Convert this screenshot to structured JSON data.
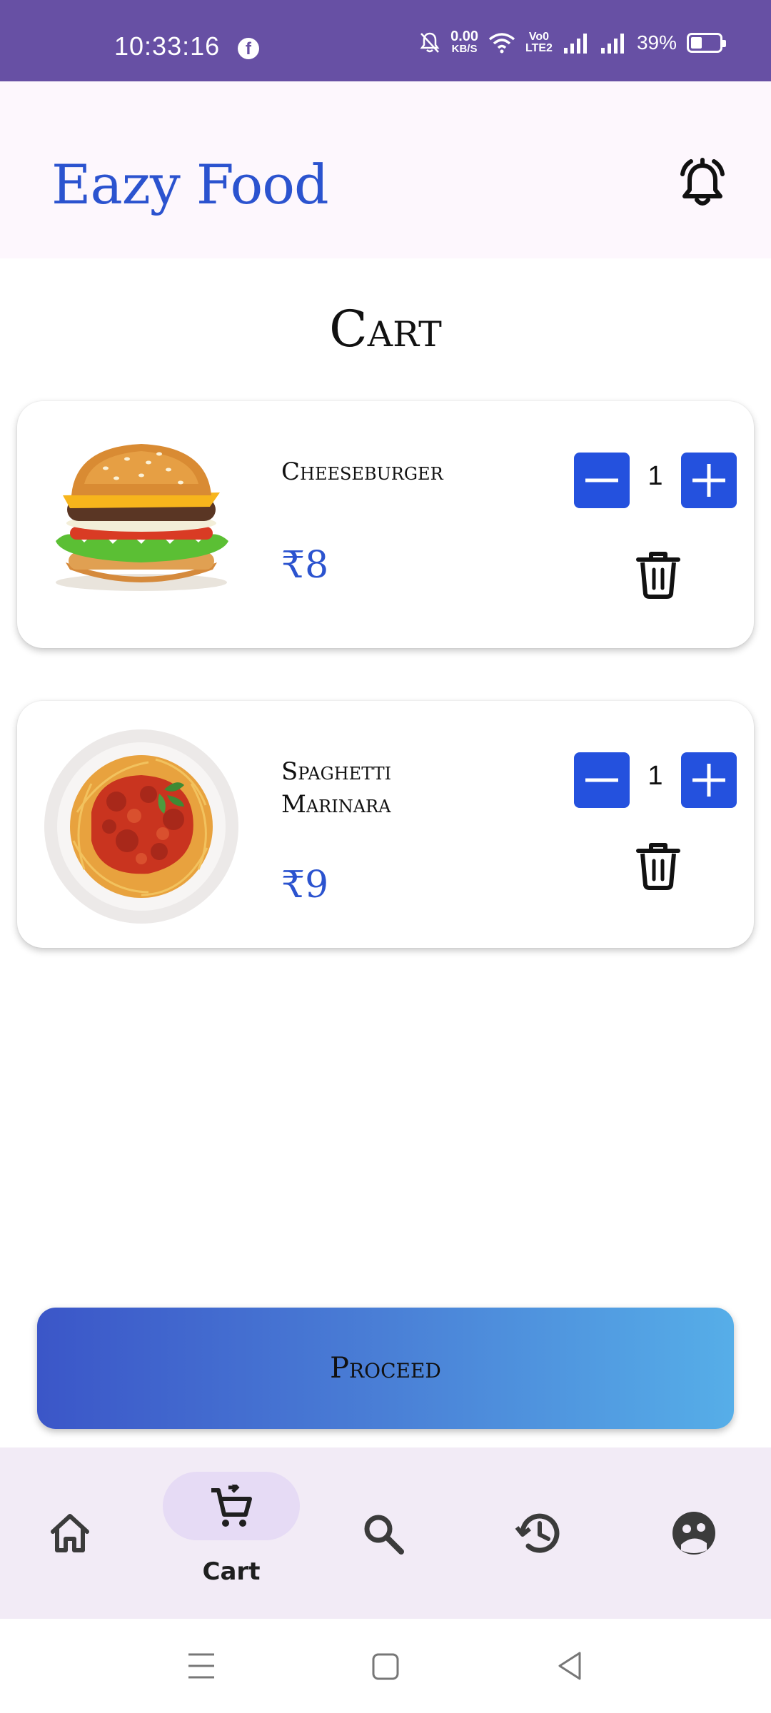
{
  "status_bar": {
    "time": "10:33:16",
    "net_speed_value": "0.00",
    "net_speed_unit": "KB/S",
    "volte_line1": "Vo0",
    "volte_line2": "LTE2",
    "battery": "39%",
    "battery_level": 0.39
  },
  "header": {
    "app_title": "Eazy Food"
  },
  "page": {
    "title": "Cart"
  },
  "cart": {
    "currency": "₹",
    "items": [
      {
        "name": "Cheeseburger",
        "price": "₹8",
        "quantity": "1",
        "image": "cheeseburger-image"
      },
      {
        "name": "Spaghetti Marinara",
        "price": "₹9",
        "quantity": "1",
        "image": "spaghetti-image"
      }
    ]
  },
  "actions": {
    "proceed_label": "Proceed"
  },
  "bottom_nav": {
    "items": [
      {
        "icon": "home-icon",
        "label": ""
      },
      {
        "icon": "cart-icon",
        "label": "Cart",
        "active": true
      },
      {
        "icon": "search-icon",
        "label": ""
      },
      {
        "icon": "history-icon",
        "label": ""
      },
      {
        "icon": "profile-icon",
        "label": ""
      }
    ]
  },
  "colors": {
    "status_bar": "#6750a4",
    "header_bg": "#fdf7fd",
    "brand": "#2b53cf",
    "qty_button": "#2451de",
    "nav_bg": "#f2ebf6",
    "nav_active_pill": "#e6dbf5"
  }
}
